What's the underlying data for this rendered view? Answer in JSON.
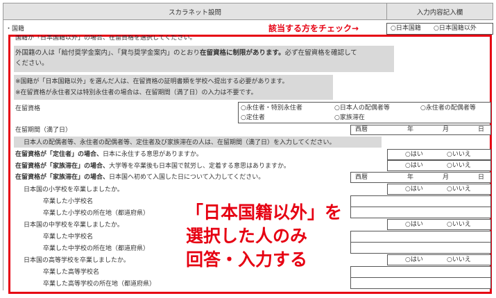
{
  "header": {
    "left_title": "スカラネット設問",
    "right_title": "入力内容記入欄"
  },
  "nationality": {
    "label": "・国籍",
    "instruction": "該当する方をチェック→",
    "options": [
      "○日本国籍",
      "○日本国籍以外"
    ]
  },
  "notes": {
    "cutoff_line": "国籍が「日本国籍以外」の場合、在留資格を選択してください。",
    "warn1_a": "外国籍の人は「給付奨学金案内」、「貸与奨学金案内」のとおり",
    "warn1_b": "在留資格に制限があります。",
    "warn1_c": "必ず在留資格を確認して",
    "warn1_d": "ください。",
    "warn2_line1": "※国籍が「日本国籍以外」を選んだ人は、在留資格の証明書類を学校へ提出する必要があります。",
    "warn2_line2": "※在留資格が永住者又は特別永住者の場合は、在留期間（満了日）の入力は不要です。"
  },
  "residence_status": {
    "label": "在留資格",
    "options": [
      "○永住者・特別永住者",
      "○日本人の配偶者等",
      "○永住者の配偶者等",
      "○定住者",
      "○家族滞在"
    ]
  },
  "residence_period": {
    "label": "在留期間（満了日）",
    "date_parts": [
      "西暦",
      "年",
      "月",
      "日"
    ],
    "note": "日本人の配偶者等、永住者の配偶者等、定住者及び家族滞在の人は、在留期間（満了日）を入力してください。"
  },
  "questions": {
    "teijusha_bold": "在留資格が「定住者」の場合、",
    "teijusha_rest": "日本に永住する意思がありますか。",
    "kazoku_bold": "在留資格が「家族滞在」の場合、",
    "kazoku_rest": "大学等を卒業後も日本国で就労し、定着する意思はありますか。",
    "entry_bold": "在留資格が「家族滞在」の場合、",
    "entry_rest": "日本国へ初めて入国した日について入力してください。",
    "yes": "○はい",
    "no": "○いいえ"
  },
  "schools": {
    "elementary": "日本国の小学校を卒業しましたか。",
    "elementary_name": "卒業した小学校名",
    "elementary_loc": "卒業した小学校の所在地（都道府県）",
    "middle": "日本国の中学校を卒業しましたか。",
    "middle_name": "卒業した中学校名",
    "middle_loc": "卒業した中学校の所在地（都道府県）",
    "high": "日本国の高等学校を卒業しましたか。",
    "high_name": "卒業した高等学校名",
    "high_loc": "卒業した高等学校の所在地（都道府県）"
  },
  "callout": {
    "line1": "「日本国籍以外」を",
    "line2": "選択した人のみ",
    "line3": "回答・入力する"
  },
  "colors": {
    "accent_red": "#e60012",
    "header_gray": "#e3e3e3",
    "note_gray": "#d9d9d9"
  }
}
